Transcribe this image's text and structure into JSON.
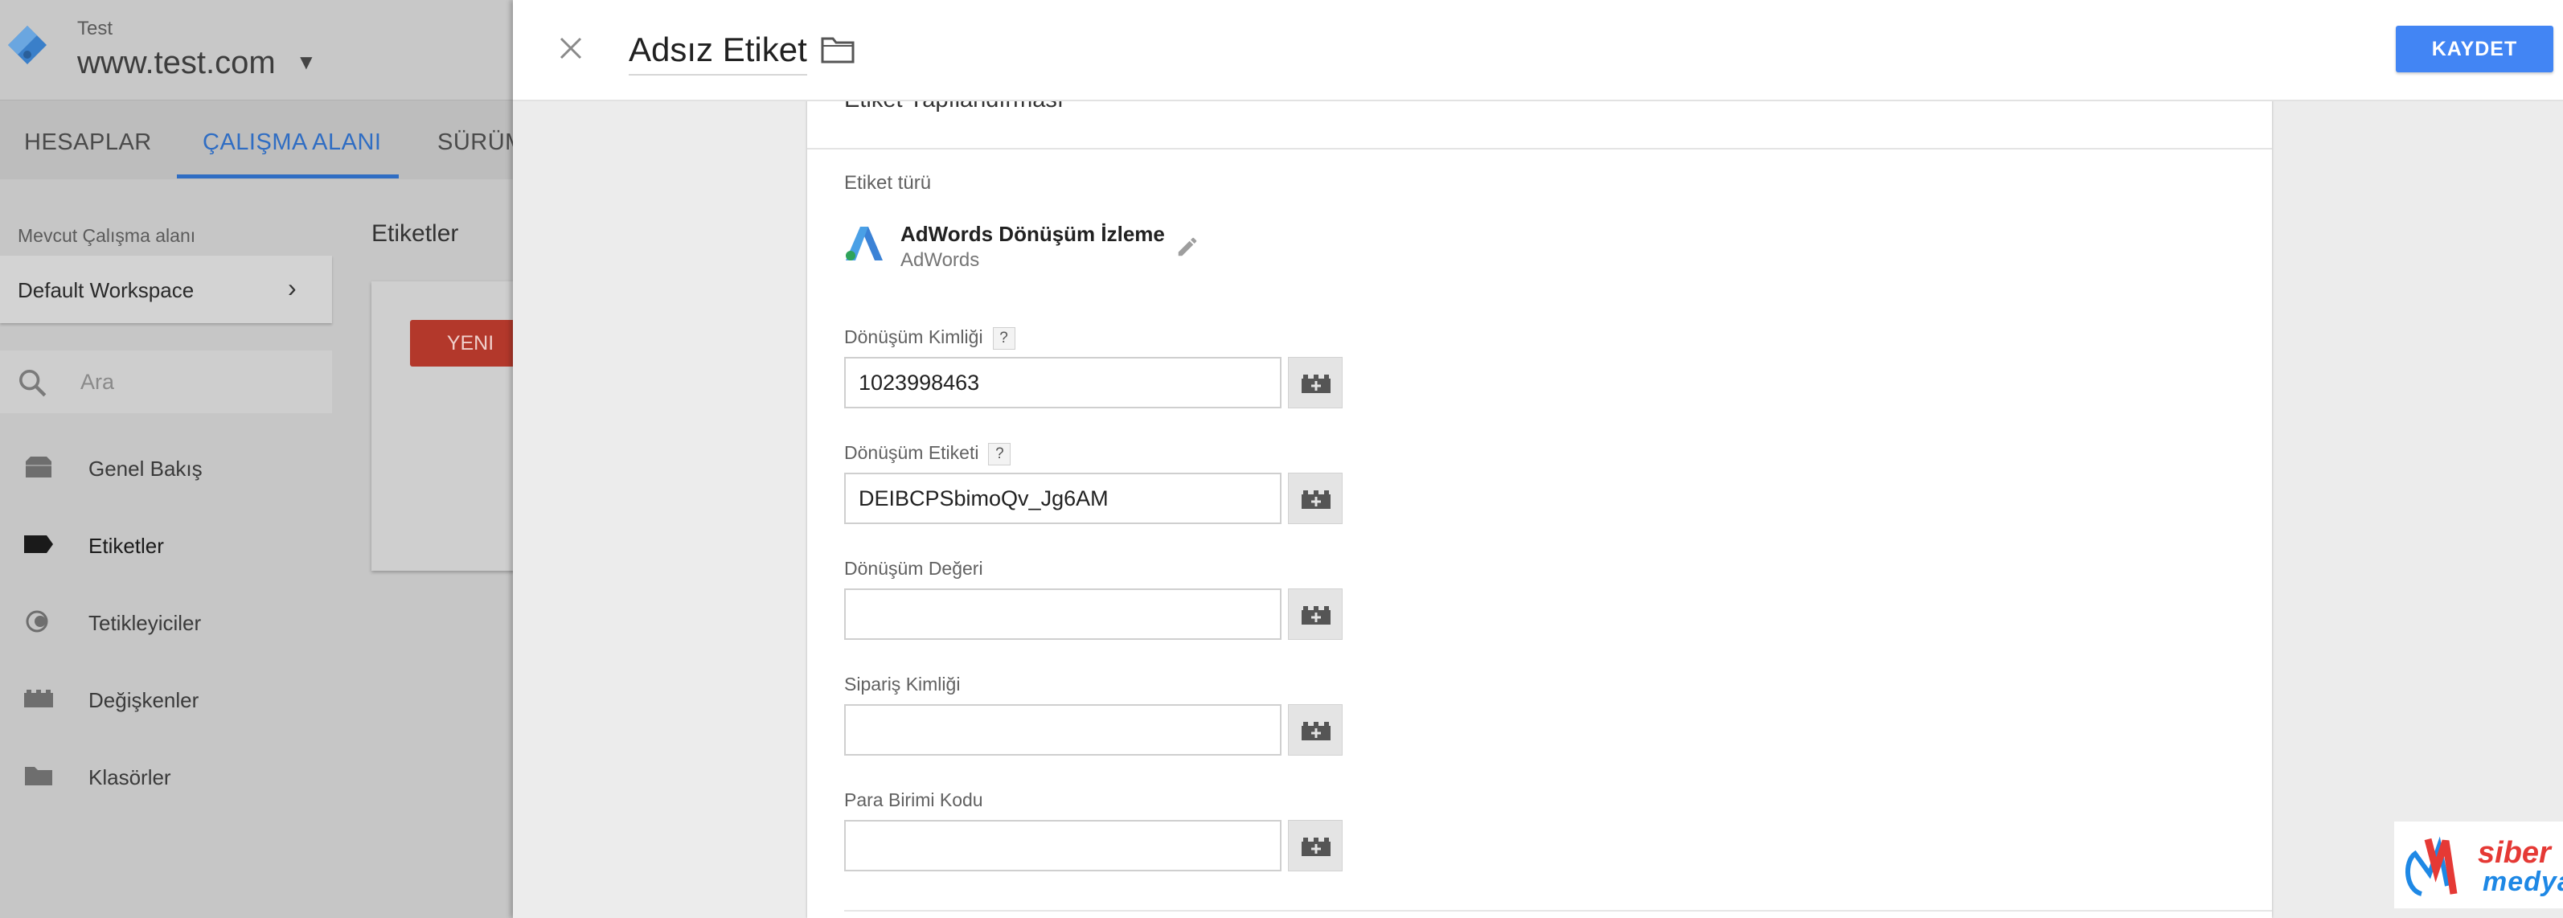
{
  "app": {
    "account": "Test",
    "container": "www.test.com",
    "top_nav": [
      "HESAPLAR",
      "ÇALIŞMA ALANI",
      "SÜRÜM"
    ],
    "workspace_label": "Mevcut Çalışma alanı",
    "workspace_name": "Default Workspace",
    "search_placeholder": "Ara",
    "sidebar": [
      {
        "label": "Genel Bakış",
        "icon": "briefcase-icon"
      },
      {
        "label": "Etiketler",
        "icon": "tag-icon"
      },
      {
        "label": "Tetikleyiciler",
        "icon": "trigger-icon"
      },
      {
        "label": "Değişkenler",
        "icon": "variable-icon"
      },
      {
        "label": "Klasörler",
        "icon": "folder-icon"
      }
    ],
    "tags_title": "Etiketler",
    "new_button": "YENI"
  },
  "editor": {
    "title": "Adsız Etiket",
    "save_button": "KAYDET",
    "section_title": "Etiket Yapılandırması",
    "tag_type_label": "Etiket türü",
    "tag_type_name": "AdWords Dönüşüm İzleme",
    "tag_type_vendor": "AdWords",
    "fields": [
      {
        "label": "Dönüşüm Kimliği",
        "value": "1023998463",
        "help": "?"
      },
      {
        "label": "Dönüşüm Etiketi",
        "value": "DEIBCPSbimoQv_Jg6AM",
        "help": "?"
      },
      {
        "label": "Dönüşüm Değeri",
        "value": ""
      },
      {
        "label": "Sipariş Kimliği",
        "value": ""
      },
      {
        "label": "Para Birimi Kodu",
        "value": ""
      }
    ]
  },
  "watermark": {
    "line1": "siber",
    "line2": "medya"
  },
  "colors": {
    "accent": "#4285f4",
    "new_button": "#c23b2c",
    "nav_active": "#2f6dc3"
  }
}
